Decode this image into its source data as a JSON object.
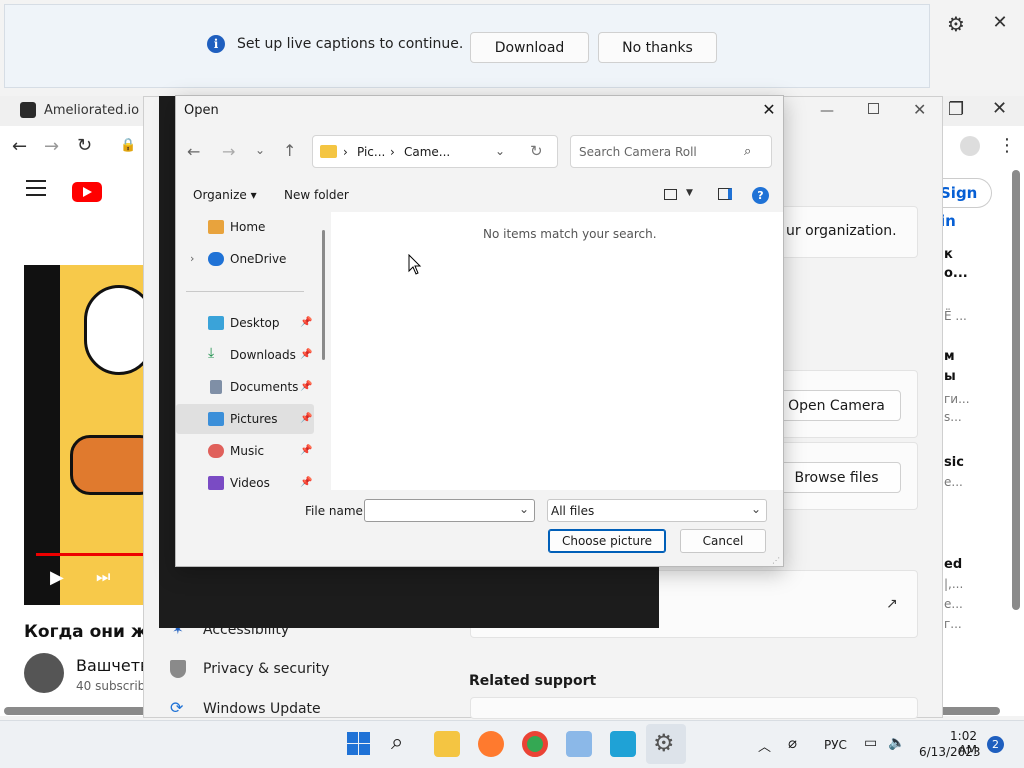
{
  "caption_bar": {
    "message": "Set up live captions to continue.",
    "download_label": "Download",
    "no_thanks_label": "No thanks",
    "info_glyph": "i"
  },
  "browser": {
    "tab_title": "Ameliorated.io",
    "signin_label": "Sign in",
    "video_title": "Когда они жд",
    "channel_name": "Вашчетв",
    "channel_subs": "40 subscribe",
    "right_snippets": [
      "к",
      "о...",
      "Ё ...",
      "м",
      "ы",
      "ги...",
      "s...",
      "sic",
      "e...",
      "ed",
      "|,...",
      "e...",
      "г..."
    ]
  },
  "settings_window": {
    "org_text": "ur organization.",
    "open_camera_label": "Open Camera",
    "browse_files_label": "Browse files",
    "related_support": "Related support",
    "nav_accessibility": "Accessibility",
    "nav_privacy": "Privacy & security",
    "nav_update": "Windows Update"
  },
  "dialog": {
    "title": "Open",
    "path_segments": [
      "Pic...",
      "Came..."
    ],
    "search_placeholder": "Search Camera Roll",
    "organize_label": "Organize ▾",
    "new_folder_label": "New folder",
    "empty_message": "No items match your search.",
    "nav_items": [
      {
        "label": "Home",
        "icon": "home-icon"
      },
      {
        "label": "OneDrive",
        "icon": "cloud-icon"
      },
      {
        "label": "Desktop",
        "icon": "desktop-icon"
      },
      {
        "label": "Downloads",
        "icon": "download-icon"
      },
      {
        "label": "Documents",
        "icon": "documents-icon"
      },
      {
        "label": "Pictures",
        "icon": "pictures-icon"
      },
      {
        "label": "Music",
        "icon": "music-icon"
      },
      {
        "label": "Videos",
        "icon": "videos-icon"
      }
    ],
    "file_name_label": "File name:",
    "file_name_value": "",
    "file_type_value": "All files",
    "choose_label": "Choose picture",
    "cancel_label": "Cancel"
  },
  "taskbar": {
    "time": "1:02 AM",
    "date": "6/13/2023",
    "language": "РУС",
    "notification_count": "2"
  },
  "colors": {
    "accent": "#005fb8",
    "youtube_red": "#ff0000",
    "folder_yellow": "#f4c542",
    "info_blue": "#1f5fbf"
  }
}
